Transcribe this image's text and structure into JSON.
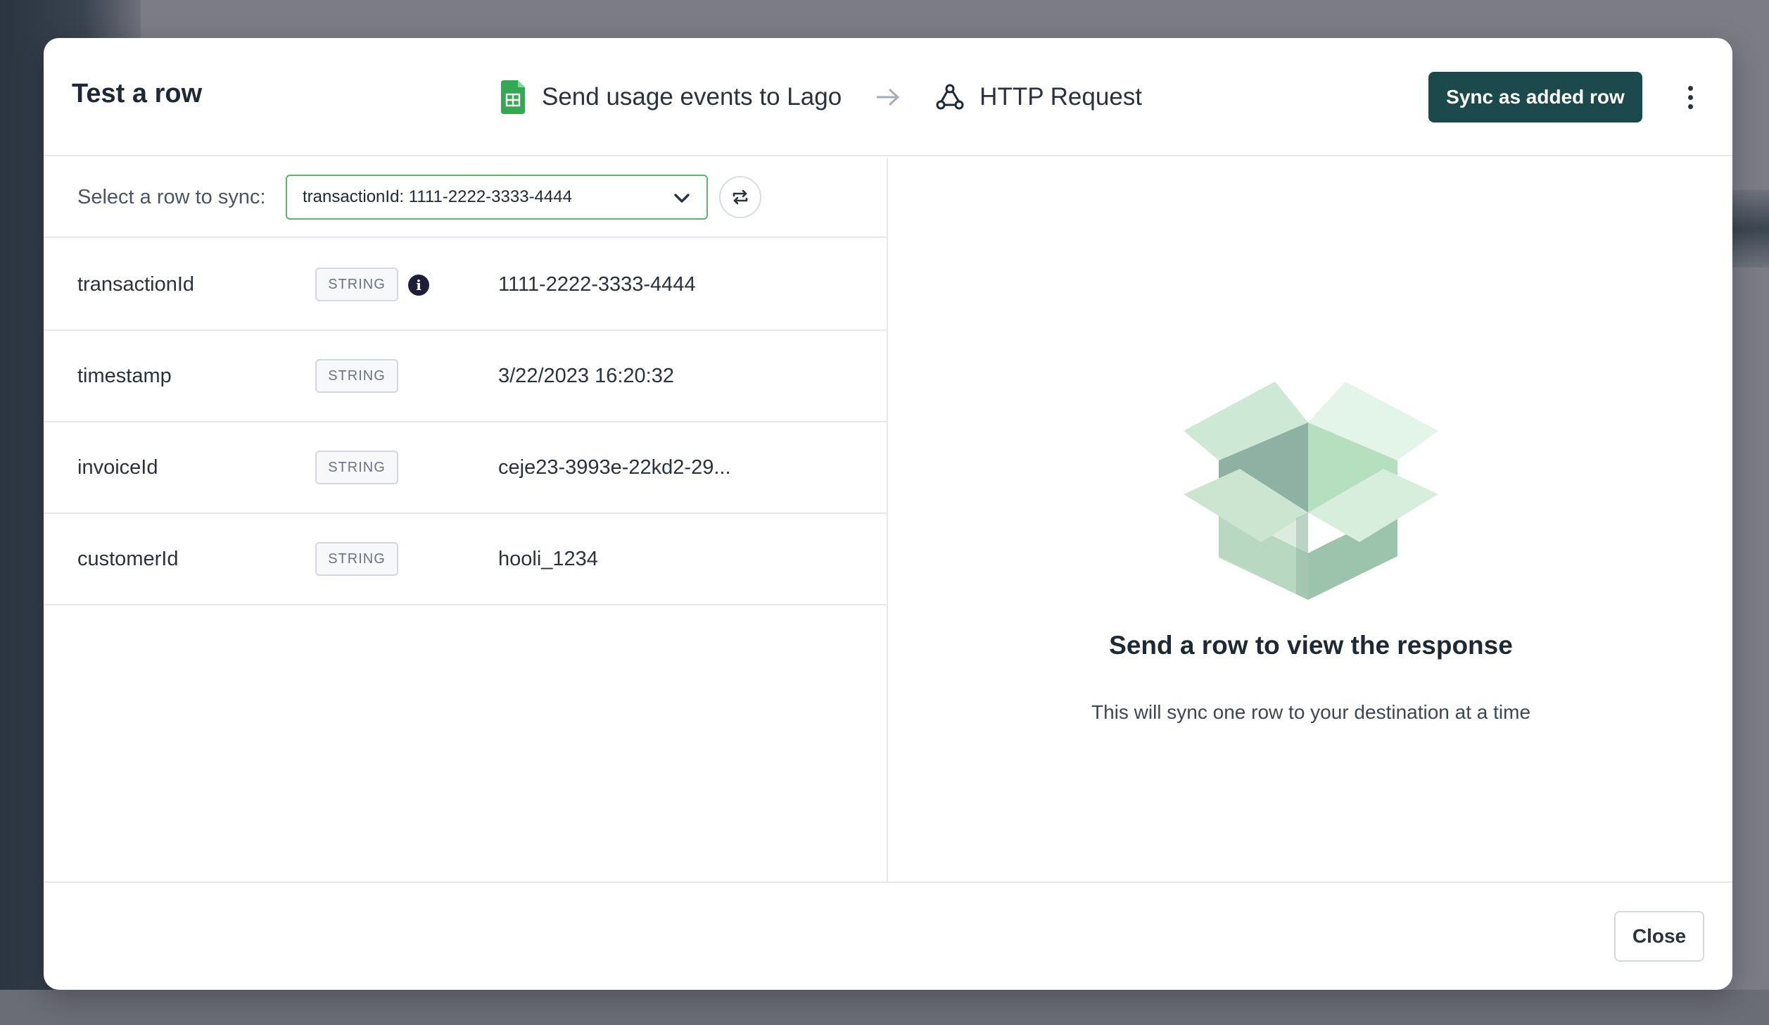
{
  "modal": {
    "title": "Test a row"
  },
  "pipeline": {
    "source_label": "Send usage events to Lago",
    "source_icon": "google-sheets-icon",
    "destination_label": "HTTP Request",
    "destination_icon": "webhook-icon"
  },
  "toolbar": {
    "sync_label": "Sync as added row",
    "sync_color": "#1c4a4c"
  },
  "row_select": {
    "label": "Select a row to sync:",
    "value": "transactionId: 1111-2222-3333-4444"
  },
  "fields": [
    {
      "name": "transactionId",
      "type": "STRING",
      "value": "1111-2222-3333-4444",
      "has_info": true
    },
    {
      "name": "timestamp",
      "type": "STRING",
      "value": "3/22/2023 16:20:32",
      "has_info": false
    },
    {
      "name": "invoiceId",
      "type": "STRING",
      "value": "ceje23-3993e-22kd2-29...",
      "has_info": false
    },
    {
      "name": "customerId",
      "type": "STRING",
      "value": "hooli_1234",
      "has_info": false
    }
  ],
  "response": {
    "empty_title": "Send a row to view the response",
    "empty_subtitle": "This will sync one row to your destination at a time"
  },
  "footer": {
    "close_label": "Close"
  },
  "info_glyph": "i"
}
